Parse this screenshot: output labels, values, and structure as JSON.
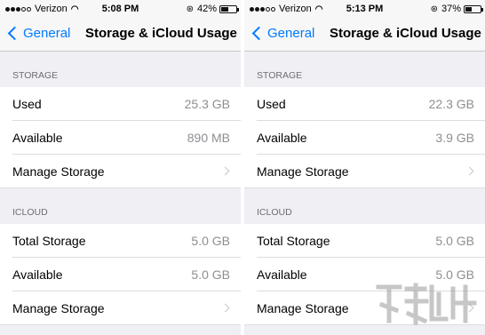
{
  "screens": [
    {
      "status": {
        "carrier": "Verizon",
        "time": "5:08 PM",
        "battery": "42%",
        "battery_level": 0.42
      },
      "nav": {
        "back_label": "General",
        "title": "Storage & iCloud Usage"
      },
      "storage": {
        "header": "STORAGE",
        "used_label": "Used",
        "used_value": "25.3 GB",
        "available_label": "Available",
        "available_value": "890 MB",
        "manage_label": "Manage Storage"
      },
      "icloud": {
        "header": "ICLOUD",
        "total_label": "Total Storage",
        "total_value": "5.0 GB",
        "available_label": "Available",
        "available_value": "5.0 GB",
        "manage_label": "Manage Storage"
      }
    },
    {
      "status": {
        "carrier": "Verizon",
        "time": "5:13 PM",
        "battery": "37%",
        "battery_level": 0.37
      },
      "nav": {
        "back_label": "General",
        "title": "Storage & iCloud Usage"
      },
      "storage": {
        "header": "STORAGE",
        "used_label": "Used",
        "used_value": "22.3 GB",
        "available_label": "Available",
        "available_value": "3.9 GB",
        "manage_label": "Manage Storage"
      },
      "icloud": {
        "header": "ICLOUD",
        "total_label": "Total Storage",
        "total_value": "5.0 GB",
        "available_label": "Available",
        "available_value": "5.0 GB",
        "manage_label": "Manage Storage"
      }
    }
  ],
  "colors": {
    "accent": "#007aff",
    "background": "#efeff4",
    "secondary_text": "#8e8e93"
  },
  "icons": [
    "signal-dots-icon",
    "wifi-icon",
    "rotation-lock-icon",
    "battery-icon",
    "chevron-left-icon",
    "chevron-right-icon"
  ]
}
